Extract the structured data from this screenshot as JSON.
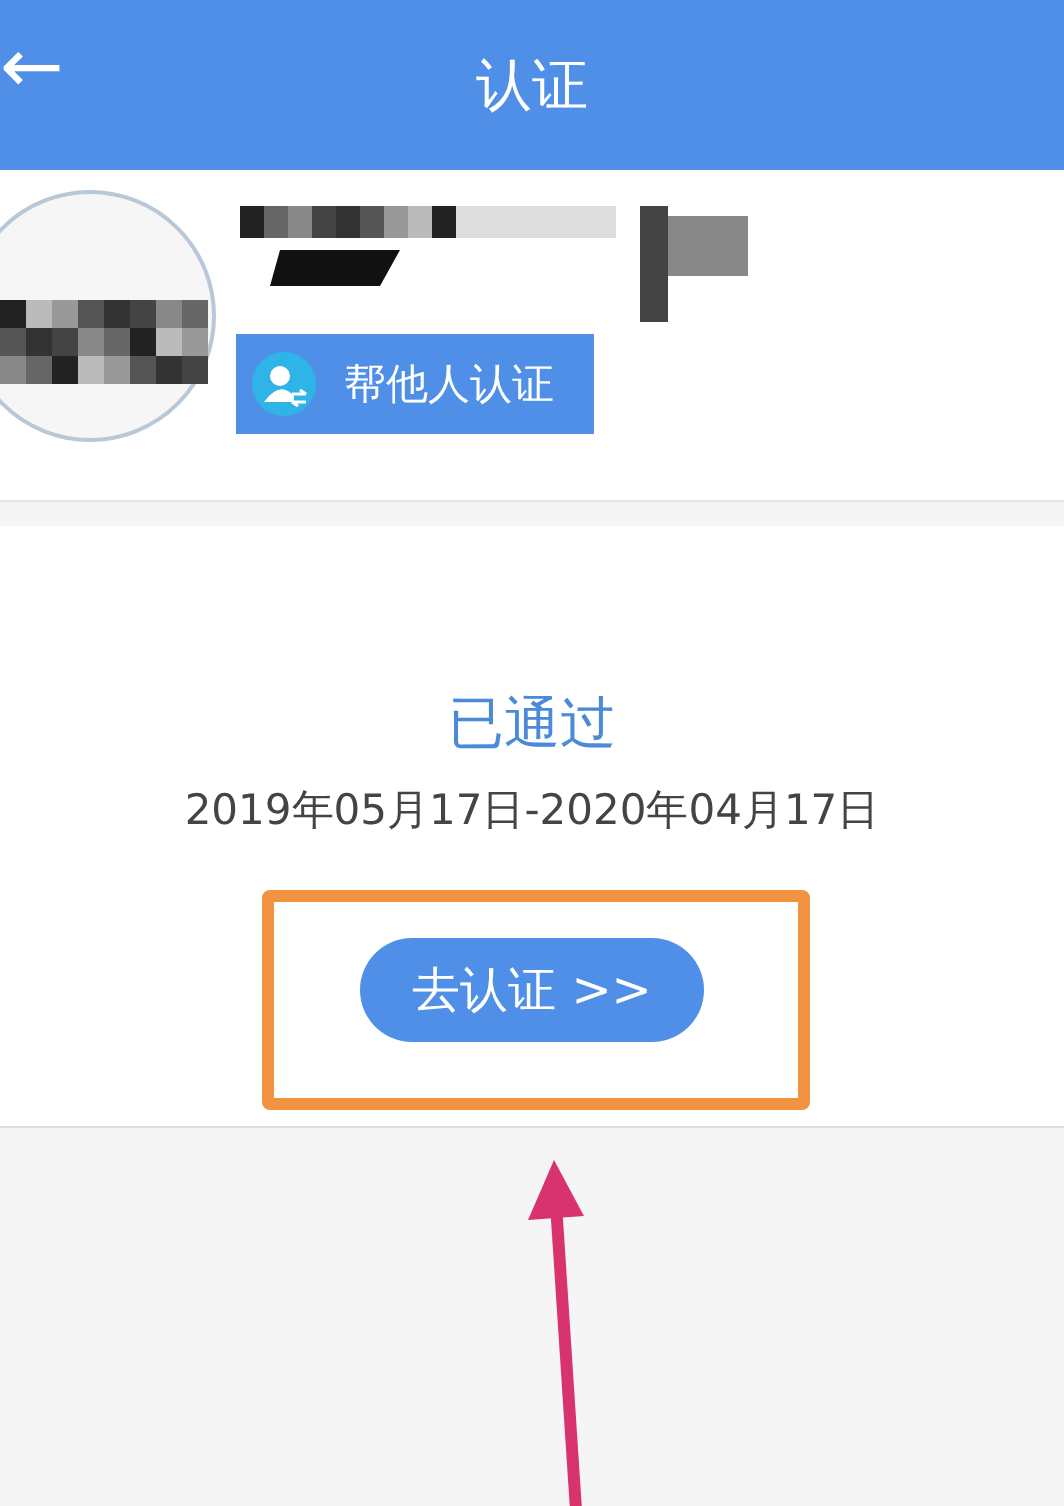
{
  "header": {
    "back_icon": "←",
    "title": "认证"
  },
  "profile": {
    "help_button": "帮他人认证"
  },
  "status": {
    "title": "已通过",
    "period": "2019年05月17日-2020年04月17日",
    "action_button": "去认证 >>"
  }
}
